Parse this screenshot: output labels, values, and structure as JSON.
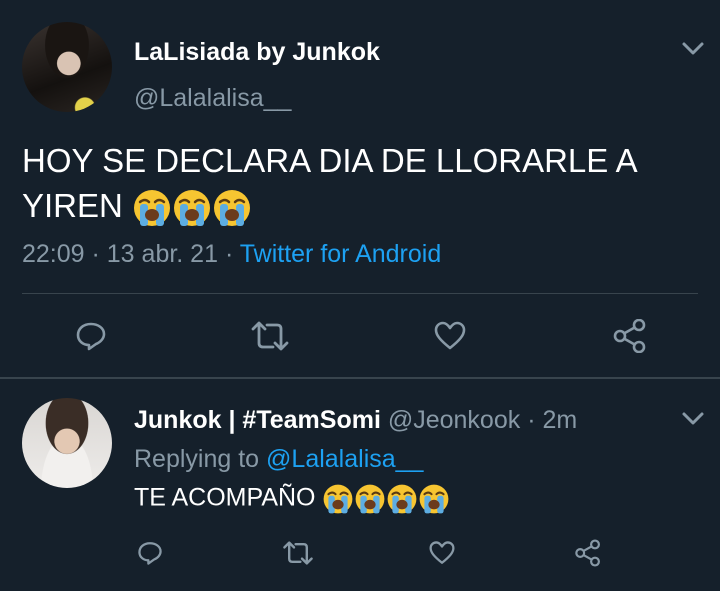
{
  "main_tweet": {
    "display_name": "LaLisiada by Junkok",
    "handle": "@Lalalalisa__",
    "text": "HOY SE DECLARA DIA DE LLORARLE A YIREN",
    "emoji_count": 3,
    "time": "22:09",
    "separator": " · ",
    "date": "13 abr. 21",
    "source": "Twitter for Android"
  },
  "reply_tweet": {
    "display_name": "Junkok | #TeamSomi",
    "handle": "@Jeonkook",
    "age": "2m",
    "replying_prefix": "Replying to",
    "replying_to": "@Lalalalisa__",
    "text": "TE ACOMPAÑO",
    "emoji_count": 4
  },
  "icons": {
    "avatar_main": "avatar",
    "chevron": "chevron-down-icon",
    "reply": "reply-icon",
    "retweet": "retweet-icon",
    "like": "heart-icon",
    "share": "share-icon",
    "emoji": "loudly-crying-face-emoji"
  },
  "colors": {
    "background": "#15202b",
    "text_primary": "#ffffff",
    "text_secondary": "#8899a6",
    "accent": "#1da1f2",
    "divider": "#38444d"
  }
}
